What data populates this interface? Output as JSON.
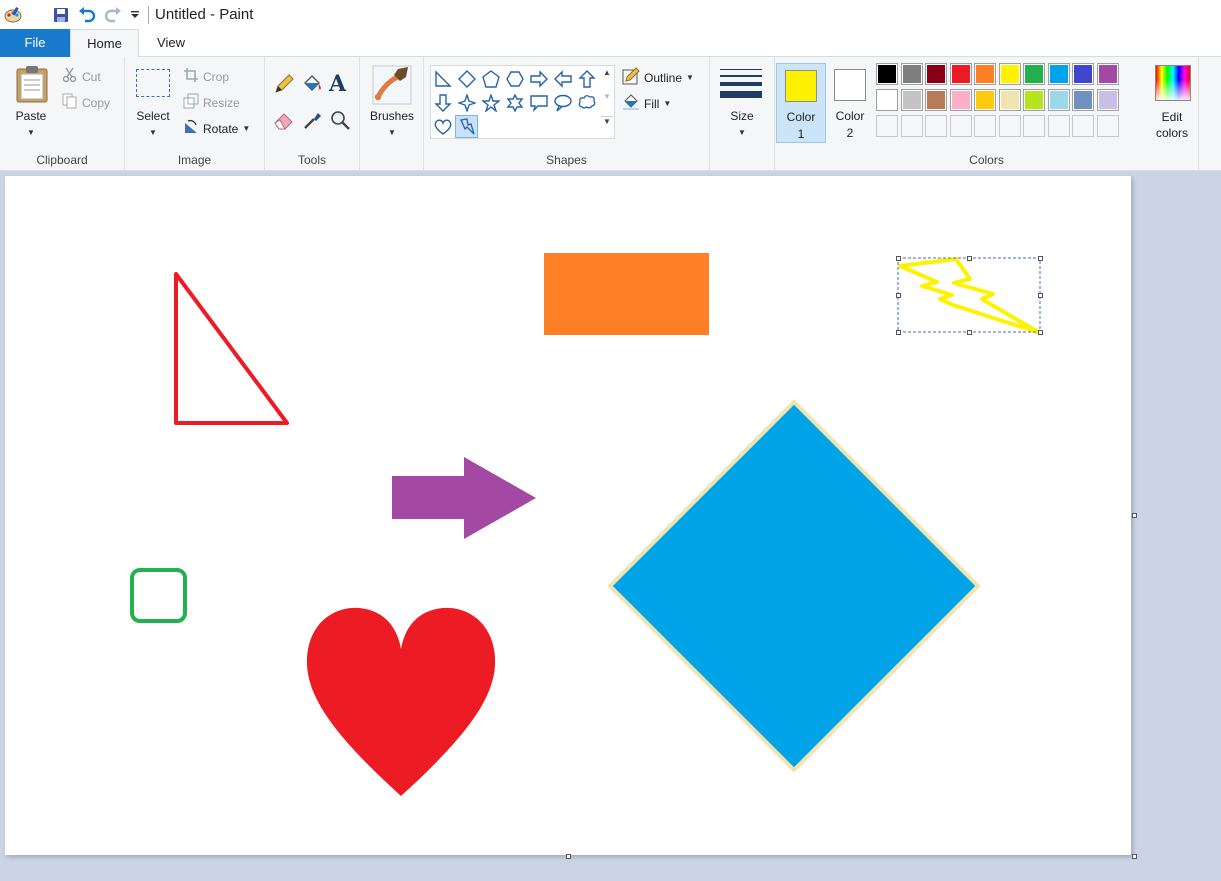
{
  "window": {
    "title": "Untitled - Paint"
  },
  "quick_access": {
    "app_icon": "paint-palette-icon",
    "save_icon": "save-icon",
    "undo_icon": "undo-icon",
    "redo_icon": "redo-icon",
    "customize_icon": "chevron-down-icon"
  },
  "tabs": [
    {
      "label": "File",
      "active": false
    },
    {
      "label": "Home",
      "active": true
    },
    {
      "label": "View",
      "active": false
    }
  ],
  "ribbon": {
    "clipboard": {
      "label": "Clipboard",
      "paste": "Paste",
      "cut": "Cut",
      "copy": "Copy"
    },
    "image": {
      "label": "Image",
      "select": "Select",
      "crop": "Crop",
      "resize": "Resize",
      "rotate": "Rotate"
    },
    "tools": {
      "label": "Tools"
    },
    "brushes": {
      "label": "Brushes"
    },
    "shapes": {
      "label": "Shapes",
      "outline": "Outline",
      "fill": "Fill",
      "selected_shape": "lightning"
    },
    "size": {
      "label": "Size"
    },
    "colors": {
      "label": "Colors",
      "color1_label": "Color",
      "color1_num": "1",
      "color2_label": "Color",
      "color2_num": "2",
      "color1_value": "#fff200",
      "color2_value": "#ffffff",
      "edit_label_1": "Edit",
      "edit_label_2": "colors",
      "palette_row1": [
        "#000000",
        "#7f7f7f",
        "#880015",
        "#ed1c24",
        "#ff7f27",
        "#fff200",
        "#22b14c",
        "#00a2e8",
        "#3f48cc",
        "#a349a4"
      ],
      "palette_row2": [
        "#ffffff",
        "#c3c3c3",
        "#b97a57",
        "#ffaec9",
        "#ffc90e",
        "#efe4b0",
        "#b5e61d",
        "#99d9ea",
        "#7092be",
        "#c8bfe7"
      ]
    }
  },
  "canvas_shapes": {
    "triangle": {
      "kind": "right-triangle",
      "outline": "#ed1c24"
    },
    "rectangle": {
      "kind": "rectangle",
      "fill": "#ff7f27"
    },
    "lightning": {
      "kind": "lightning",
      "outline": "#fff200",
      "selected": true
    },
    "arrow": {
      "kind": "right-arrow",
      "fill": "#a349a4"
    },
    "rounded_rect": {
      "kind": "rounded-rectangle",
      "outline": "#22b14c"
    },
    "heart": {
      "kind": "heart",
      "fill": "#ed1c24"
    },
    "diamond": {
      "kind": "diamond",
      "fill": "#00a2e8",
      "outline": "#efe4b0"
    }
  }
}
